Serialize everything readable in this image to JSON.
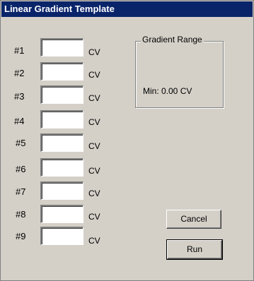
{
  "window": {
    "title": "Linear Gradient Template"
  },
  "rows": [
    {
      "label": "#1",
      "value": "",
      "unit": "CV"
    },
    {
      "label": "#2",
      "value": "",
      "unit": "CV"
    },
    {
      "label": "#3",
      "value": "",
      "unit": "CV"
    },
    {
      "label": "#4",
      "value": "",
      "unit": "CV"
    },
    {
      "label": "#5",
      "value": "",
      "unit": "CV"
    },
    {
      "label": "#6",
      "value": "",
      "unit": "CV"
    },
    {
      "label": "#7",
      "value": "",
      "unit": "CV"
    },
    {
      "label": "#8",
      "value": "",
      "unit": "CV"
    },
    {
      "label": "#9",
      "value": "",
      "unit": "CV"
    }
  ],
  "gradient_range": {
    "title": "Gradient Range",
    "min_text": "Min: 0.00 CV"
  },
  "buttons": {
    "cancel_label": "Cancel",
    "run_label": "Run"
  },
  "colors": {
    "titlebar": "#0a246a",
    "window_bg": "#d4d0c8"
  }
}
